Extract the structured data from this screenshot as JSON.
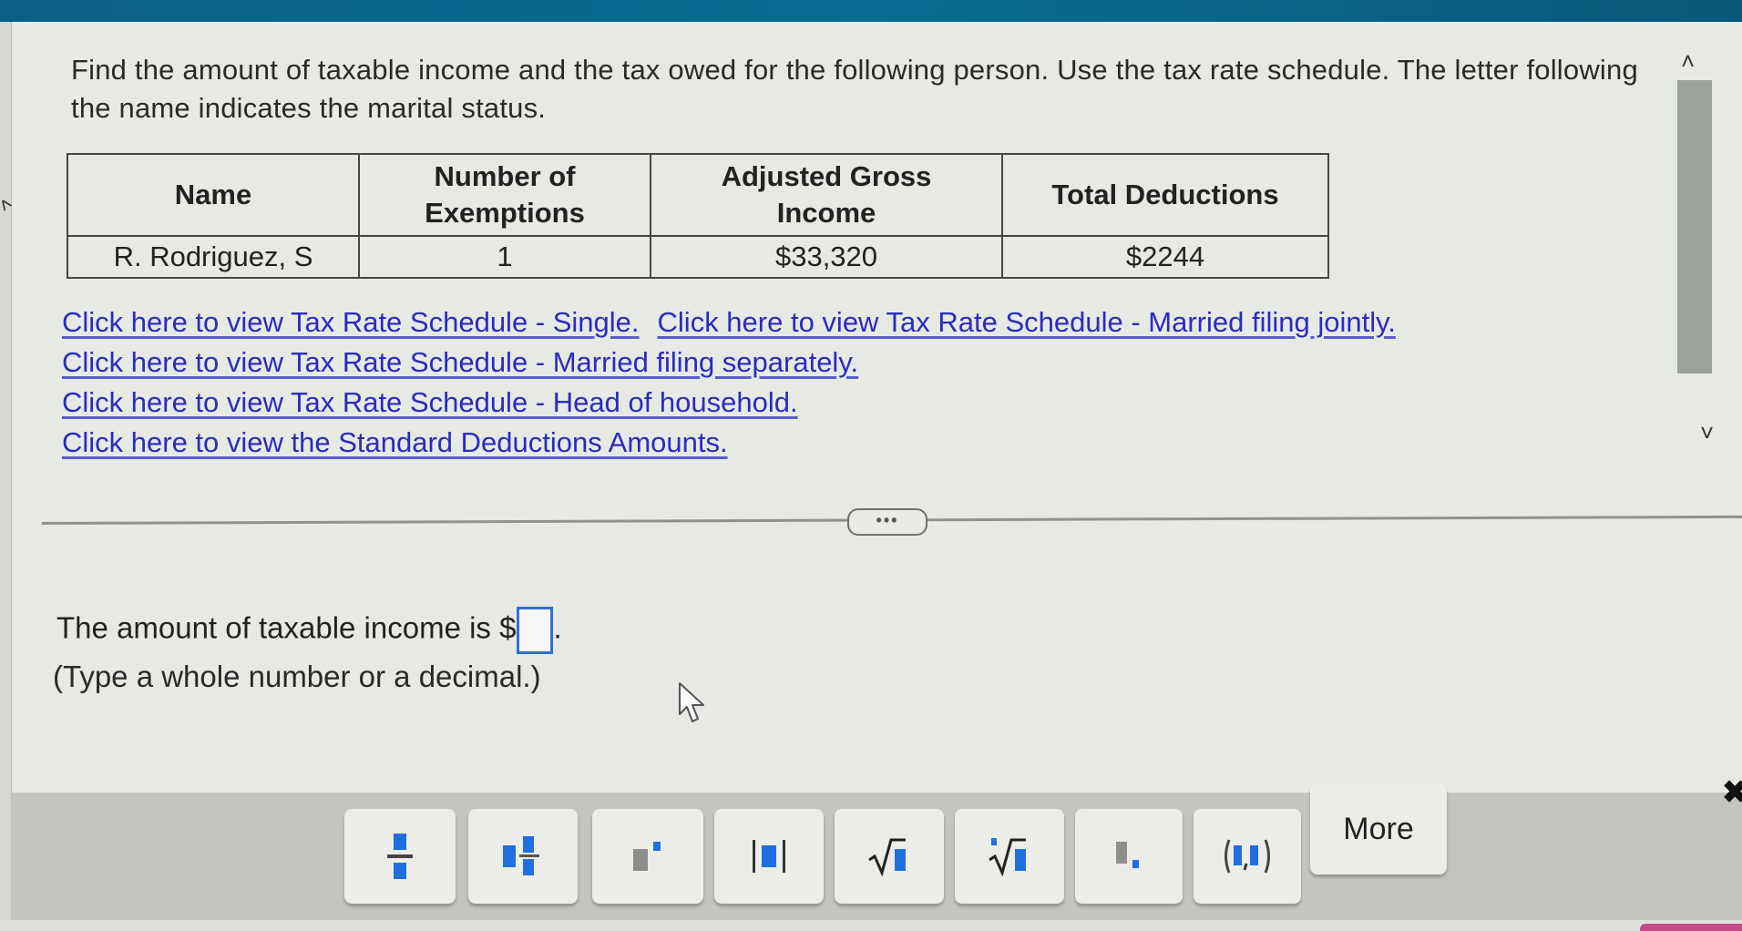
{
  "question": {
    "text": "Find the amount of taxable income and the tax owed for the following person. Use the tax rate schedule. The letter following the name indicates the marital status."
  },
  "table": {
    "headers": [
      "Name",
      "Number of Exemptions",
      "Adjusted Gross Income",
      "Total Deductions"
    ],
    "rows": [
      [
        "R. Rodriguez, S",
        "1",
        "$33,320",
        "$2244"
      ]
    ]
  },
  "links": {
    "single": "Click here to view Tax Rate Schedule - Single.",
    "married_jointly": "Click here to view Tax Rate Schedule - Married filing jointly.",
    "married_separately": "Click here to view Tax Rate Schedule - Married filing separately.",
    "head_of_household": "Click here to view Tax Rate Schedule - Head of household.",
    "standard_deductions": "Click here to view the Standard Deductions Amounts."
  },
  "divider": {
    "more_label": "•••"
  },
  "answer": {
    "prompt": "The amount of taxable income is $",
    "suffix": ".",
    "value": "",
    "hint": "(Type a whole number or a decimal.)"
  },
  "toolbar": {
    "buttons": [
      {
        "icon": "fraction-icon"
      },
      {
        "icon": "mixed-number-icon"
      },
      {
        "icon": "exponent-icon"
      },
      {
        "icon": "absolute-value-icon"
      },
      {
        "icon": "square-root-icon"
      },
      {
        "icon": "nth-root-icon"
      },
      {
        "icon": "decimal-icon"
      },
      {
        "icon": "ordered-pair-icon"
      }
    ],
    "more_label": "More",
    "close_label": "✖"
  },
  "scrollbar": {
    "up": "˄",
    "down": "˅"
  },
  "colors": {
    "link": "#2b2bbf",
    "accent": "#1f6fe0",
    "topbar": "#0b5f86"
  }
}
